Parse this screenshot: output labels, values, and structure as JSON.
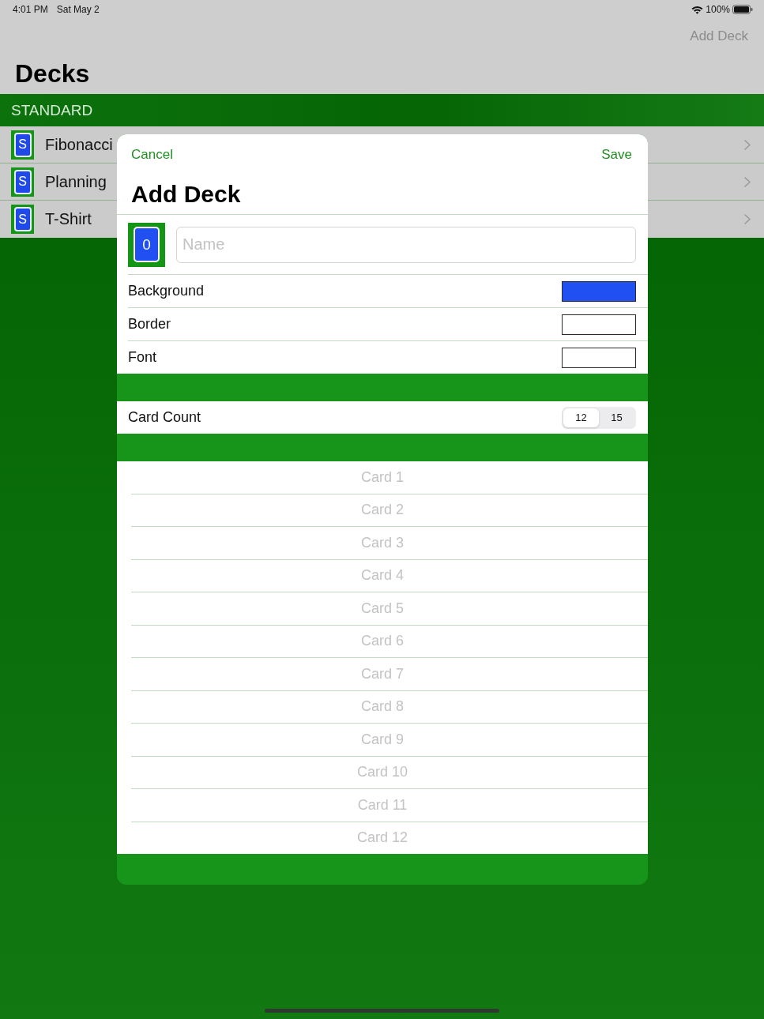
{
  "status_bar": {
    "time": "4:01 PM",
    "date": "Sat May 2",
    "battery": "100%"
  },
  "nav_bar": {
    "action": "Add Deck",
    "title": "Decks"
  },
  "deck_list": {
    "header": "STANDARD",
    "decks": [
      {
        "name": "Fibonacci",
        "symbol": "S"
      },
      {
        "name": "Planning",
        "symbol": "S"
      },
      {
        "name": "T-Shirt",
        "symbol": "S"
      }
    ]
  },
  "sheet": {
    "cancel": "Cancel",
    "save": "Save",
    "title": "Add Deck",
    "preview_symbol": "0",
    "name_field": {
      "placeholder": "Name"
    },
    "colors": [
      {
        "label": "Background",
        "color": "#2150f2"
      },
      {
        "label": "Border",
        "color": "#ffffff"
      },
      {
        "label": "Font",
        "color": "#ffffff"
      }
    ],
    "card_count": {
      "label": "Card Count",
      "options": [
        {
          "label": "12",
          "selected": true
        },
        {
          "label": "15",
          "selected": false
        }
      ]
    },
    "cards": [
      {
        "placeholder": "Card 1"
      },
      {
        "placeholder": "Card 2"
      },
      {
        "placeholder": "Card 3"
      },
      {
        "placeholder": "Card 4"
      },
      {
        "placeholder": "Card 5"
      },
      {
        "placeholder": "Card 6"
      },
      {
        "placeholder": "Card 7"
      },
      {
        "placeholder": "Card 8"
      },
      {
        "placeholder": "Card 9"
      },
      {
        "placeholder": "Card 10"
      },
      {
        "placeholder": "Card 11"
      },
      {
        "placeholder": "Card 12"
      }
    ]
  }
}
